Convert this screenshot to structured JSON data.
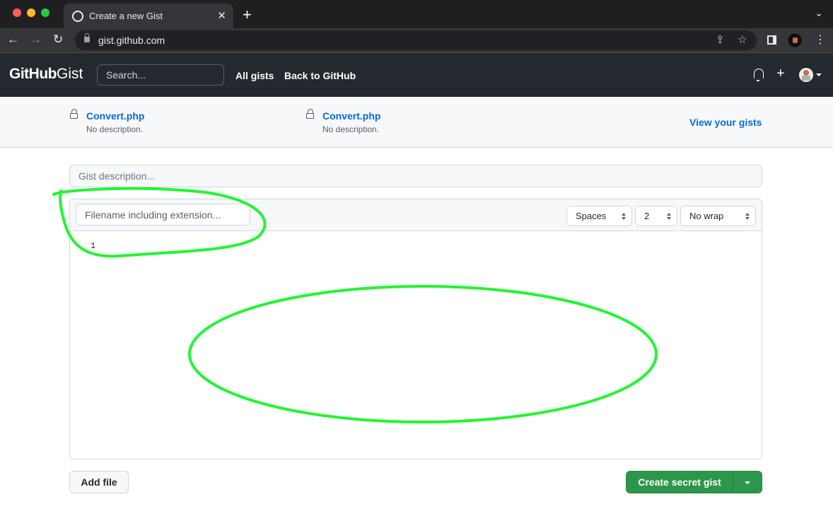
{
  "browser": {
    "tab_title": "Create a new Gist",
    "url": "gist.github.com",
    "traffic_lights": [
      "#ff5f57",
      "#febc2e",
      "#28c840"
    ]
  },
  "header": {
    "logo_bold": "GitHub",
    "logo_light": "Gist",
    "search_placeholder": "Search...",
    "links": [
      "All gists",
      "Back to GitHub"
    ]
  },
  "recent_gists": [
    {
      "name": "Convert.php",
      "description": "No description.",
      "visibility": "secret"
    },
    {
      "name": "Convert.php",
      "description": "No description.",
      "visibility": "secret"
    }
  ],
  "view_gists_label": "View your gists",
  "form": {
    "description_placeholder": "Gist description...",
    "filename_placeholder": "Filename including extension...",
    "indent_mode": "Spaces",
    "indent_size": "2",
    "wrap_mode": "No wrap",
    "line_numbers": [
      "1"
    ]
  },
  "buttons": {
    "add_file": "Add file",
    "create": "Create secret gist"
  },
  "annotations": {
    "color": "#22f533"
  }
}
